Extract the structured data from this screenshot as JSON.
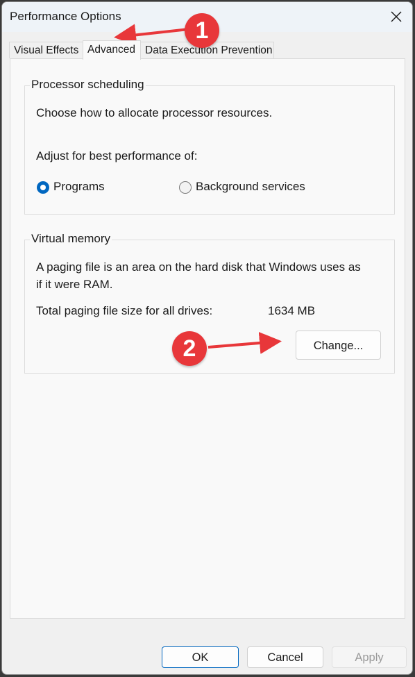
{
  "window": {
    "title": "Performance Options",
    "close_icon": "close-x-icon"
  },
  "tabs": [
    {
      "label": "Visual Effects",
      "active": false
    },
    {
      "label": "Advanced",
      "active": true
    },
    {
      "label": "Data Execution Prevention",
      "active": false
    }
  ],
  "processor_scheduling": {
    "legend": "Processor scheduling",
    "description": "Choose how to allocate processor resources.",
    "adjust_label": "Adjust for best performance of:",
    "options": [
      {
        "label": "Programs",
        "selected": true
      },
      {
        "label": "Background services",
        "selected": false
      }
    ]
  },
  "virtual_memory": {
    "legend": "Virtual memory",
    "description_line1": "A paging file is an area on the hard disk that Windows uses as",
    "description_line2": "if it were RAM.",
    "total_label": "Total paging file size for all drives:",
    "total_value": "1634 MB",
    "change_button": "Change..."
  },
  "footer": {
    "ok": "OK",
    "cancel": "Cancel",
    "apply": "Apply",
    "apply_enabled": false
  },
  "annotations": [
    {
      "number": "1",
      "target": "Advanced tab"
    },
    {
      "number": "2",
      "target": "Change... button"
    }
  ],
  "colors": {
    "accent": "#0067c0",
    "annotation_red": "#e8373a"
  }
}
